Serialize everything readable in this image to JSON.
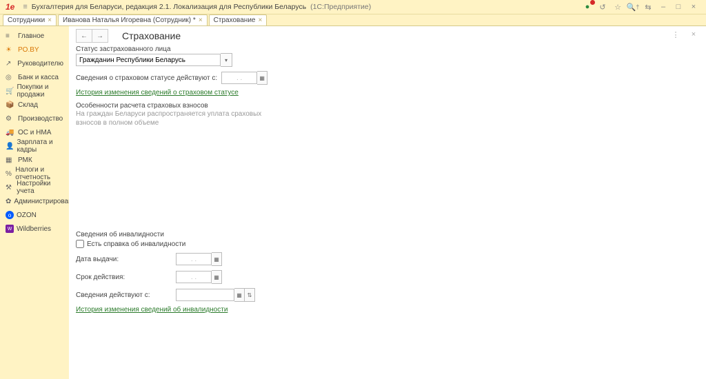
{
  "header": {
    "app_title": "Бухгалтерия для Беларуси, редакция 2.1. Локализация для Республики Беларусь",
    "app_subtitle": "(1С:Предприятие)"
  },
  "tabs": [
    {
      "label": "Сотрудники"
    },
    {
      "label": "Иванова Наталья Игоревна (Сотрудник) *"
    },
    {
      "label": "Страхование"
    }
  ],
  "sidebar": [
    {
      "icon": "≡",
      "label": "Главное"
    },
    {
      "icon": "☀",
      "label": "PO.BY",
      "active": true
    },
    {
      "icon": "↗",
      "label": "Руководителю"
    },
    {
      "icon": "◎",
      "label": "Банк и касса"
    },
    {
      "icon": "🛒",
      "label": "Покупки и продажи"
    },
    {
      "icon": "📦",
      "label": "Склад"
    },
    {
      "icon": "⚙",
      "label": "Производство"
    },
    {
      "icon": "🚚",
      "label": "ОС и НМА"
    },
    {
      "icon": "👤",
      "label": "Зарплата и кадры"
    },
    {
      "icon": "▦",
      "label": "РМК"
    },
    {
      "icon": "%",
      "label": "Налоги и отчетность"
    },
    {
      "icon": "⚒",
      "label": "Настройки учета"
    },
    {
      "icon": "✿",
      "label": "Администрирование"
    },
    {
      "icon": "o",
      "label": "OZON",
      "class": "ozon"
    },
    {
      "icon": "W",
      "label": "Wildberries",
      "class": "wb"
    }
  ],
  "page": {
    "title": "Страхование",
    "status_label": "Статус застрахованного лица",
    "status_value": "Гражданин Республики Беларусь",
    "actfrom_label": "Сведения о страховом статусе действуют с:",
    "date_placeholder": ". .",
    "history_status_link": "История изменения сведений о страховом статусе",
    "features_header": "Особенности расчета страховых взносов",
    "features_hint": "На граждан Беларуси распространяется уплата сраховых взносов в полном объеме",
    "disability_header": "Сведения об инвалидности",
    "has_cert_label": "Есть справка об инвалидности",
    "cert_date_label": "Дата выдачи:",
    "cert_term_label": "Срок действия:",
    "cert_actfrom_label": "Сведения действуют с:",
    "history_disability_link": "История изменения сведений об инвалидности"
  }
}
